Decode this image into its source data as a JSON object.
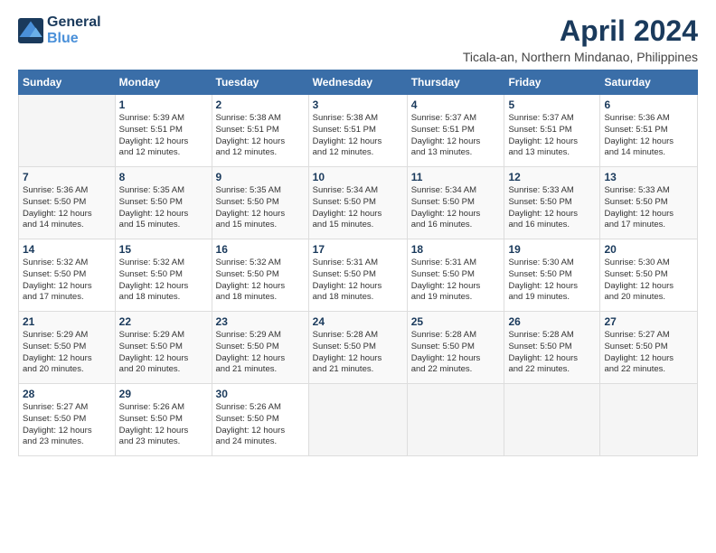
{
  "logo": {
    "line1": "General",
    "line2": "Blue"
  },
  "title": "April 2024",
  "location": "Ticala-an, Northern Mindanao, Philippines",
  "weekdays": [
    "Sunday",
    "Monday",
    "Tuesday",
    "Wednesday",
    "Thursday",
    "Friday",
    "Saturday"
  ],
  "weeks": [
    [
      {
        "day": "",
        "info": ""
      },
      {
        "day": "1",
        "info": "Sunrise: 5:39 AM\nSunset: 5:51 PM\nDaylight: 12 hours\nand 12 minutes."
      },
      {
        "day": "2",
        "info": "Sunrise: 5:38 AM\nSunset: 5:51 PM\nDaylight: 12 hours\nand 12 minutes."
      },
      {
        "day": "3",
        "info": "Sunrise: 5:38 AM\nSunset: 5:51 PM\nDaylight: 12 hours\nand 12 minutes."
      },
      {
        "day": "4",
        "info": "Sunrise: 5:37 AM\nSunset: 5:51 PM\nDaylight: 12 hours\nand 13 minutes."
      },
      {
        "day": "5",
        "info": "Sunrise: 5:37 AM\nSunset: 5:51 PM\nDaylight: 12 hours\nand 13 minutes."
      },
      {
        "day": "6",
        "info": "Sunrise: 5:36 AM\nSunset: 5:51 PM\nDaylight: 12 hours\nand 14 minutes."
      }
    ],
    [
      {
        "day": "7",
        "info": "Sunrise: 5:36 AM\nSunset: 5:50 PM\nDaylight: 12 hours\nand 14 minutes."
      },
      {
        "day": "8",
        "info": "Sunrise: 5:35 AM\nSunset: 5:50 PM\nDaylight: 12 hours\nand 15 minutes."
      },
      {
        "day": "9",
        "info": "Sunrise: 5:35 AM\nSunset: 5:50 PM\nDaylight: 12 hours\nand 15 minutes."
      },
      {
        "day": "10",
        "info": "Sunrise: 5:34 AM\nSunset: 5:50 PM\nDaylight: 12 hours\nand 15 minutes."
      },
      {
        "day": "11",
        "info": "Sunrise: 5:34 AM\nSunset: 5:50 PM\nDaylight: 12 hours\nand 16 minutes."
      },
      {
        "day": "12",
        "info": "Sunrise: 5:33 AM\nSunset: 5:50 PM\nDaylight: 12 hours\nand 16 minutes."
      },
      {
        "day": "13",
        "info": "Sunrise: 5:33 AM\nSunset: 5:50 PM\nDaylight: 12 hours\nand 17 minutes."
      }
    ],
    [
      {
        "day": "14",
        "info": "Sunrise: 5:32 AM\nSunset: 5:50 PM\nDaylight: 12 hours\nand 17 minutes."
      },
      {
        "day": "15",
        "info": "Sunrise: 5:32 AM\nSunset: 5:50 PM\nDaylight: 12 hours\nand 18 minutes."
      },
      {
        "day": "16",
        "info": "Sunrise: 5:32 AM\nSunset: 5:50 PM\nDaylight: 12 hours\nand 18 minutes."
      },
      {
        "day": "17",
        "info": "Sunrise: 5:31 AM\nSunset: 5:50 PM\nDaylight: 12 hours\nand 18 minutes."
      },
      {
        "day": "18",
        "info": "Sunrise: 5:31 AM\nSunset: 5:50 PM\nDaylight: 12 hours\nand 19 minutes."
      },
      {
        "day": "19",
        "info": "Sunrise: 5:30 AM\nSunset: 5:50 PM\nDaylight: 12 hours\nand 19 minutes."
      },
      {
        "day": "20",
        "info": "Sunrise: 5:30 AM\nSunset: 5:50 PM\nDaylight: 12 hours\nand 20 minutes."
      }
    ],
    [
      {
        "day": "21",
        "info": "Sunrise: 5:29 AM\nSunset: 5:50 PM\nDaylight: 12 hours\nand 20 minutes."
      },
      {
        "day": "22",
        "info": "Sunrise: 5:29 AM\nSunset: 5:50 PM\nDaylight: 12 hours\nand 20 minutes."
      },
      {
        "day": "23",
        "info": "Sunrise: 5:29 AM\nSunset: 5:50 PM\nDaylight: 12 hours\nand 21 minutes."
      },
      {
        "day": "24",
        "info": "Sunrise: 5:28 AM\nSunset: 5:50 PM\nDaylight: 12 hours\nand 21 minutes."
      },
      {
        "day": "25",
        "info": "Sunrise: 5:28 AM\nSunset: 5:50 PM\nDaylight: 12 hours\nand 22 minutes."
      },
      {
        "day": "26",
        "info": "Sunrise: 5:28 AM\nSunset: 5:50 PM\nDaylight: 12 hours\nand 22 minutes."
      },
      {
        "day": "27",
        "info": "Sunrise: 5:27 AM\nSunset: 5:50 PM\nDaylight: 12 hours\nand 22 minutes."
      }
    ],
    [
      {
        "day": "28",
        "info": "Sunrise: 5:27 AM\nSunset: 5:50 PM\nDaylight: 12 hours\nand 23 minutes."
      },
      {
        "day": "29",
        "info": "Sunrise: 5:26 AM\nSunset: 5:50 PM\nDaylight: 12 hours\nand 23 minutes."
      },
      {
        "day": "30",
        "info": "Sunrise: 5:26 AM\nSunset: 5:50 PM\nDaylight: 12 hours\nand 24 minutes."
      },
      {
        "day": "",
        "info": ""
      },
      {
        "day": "",
        "info": ""
      },
      {
        "day": "",
        "info": ""
      },
      {
        "day": "",
        "info": ""
      }
    ]
  ]
}
